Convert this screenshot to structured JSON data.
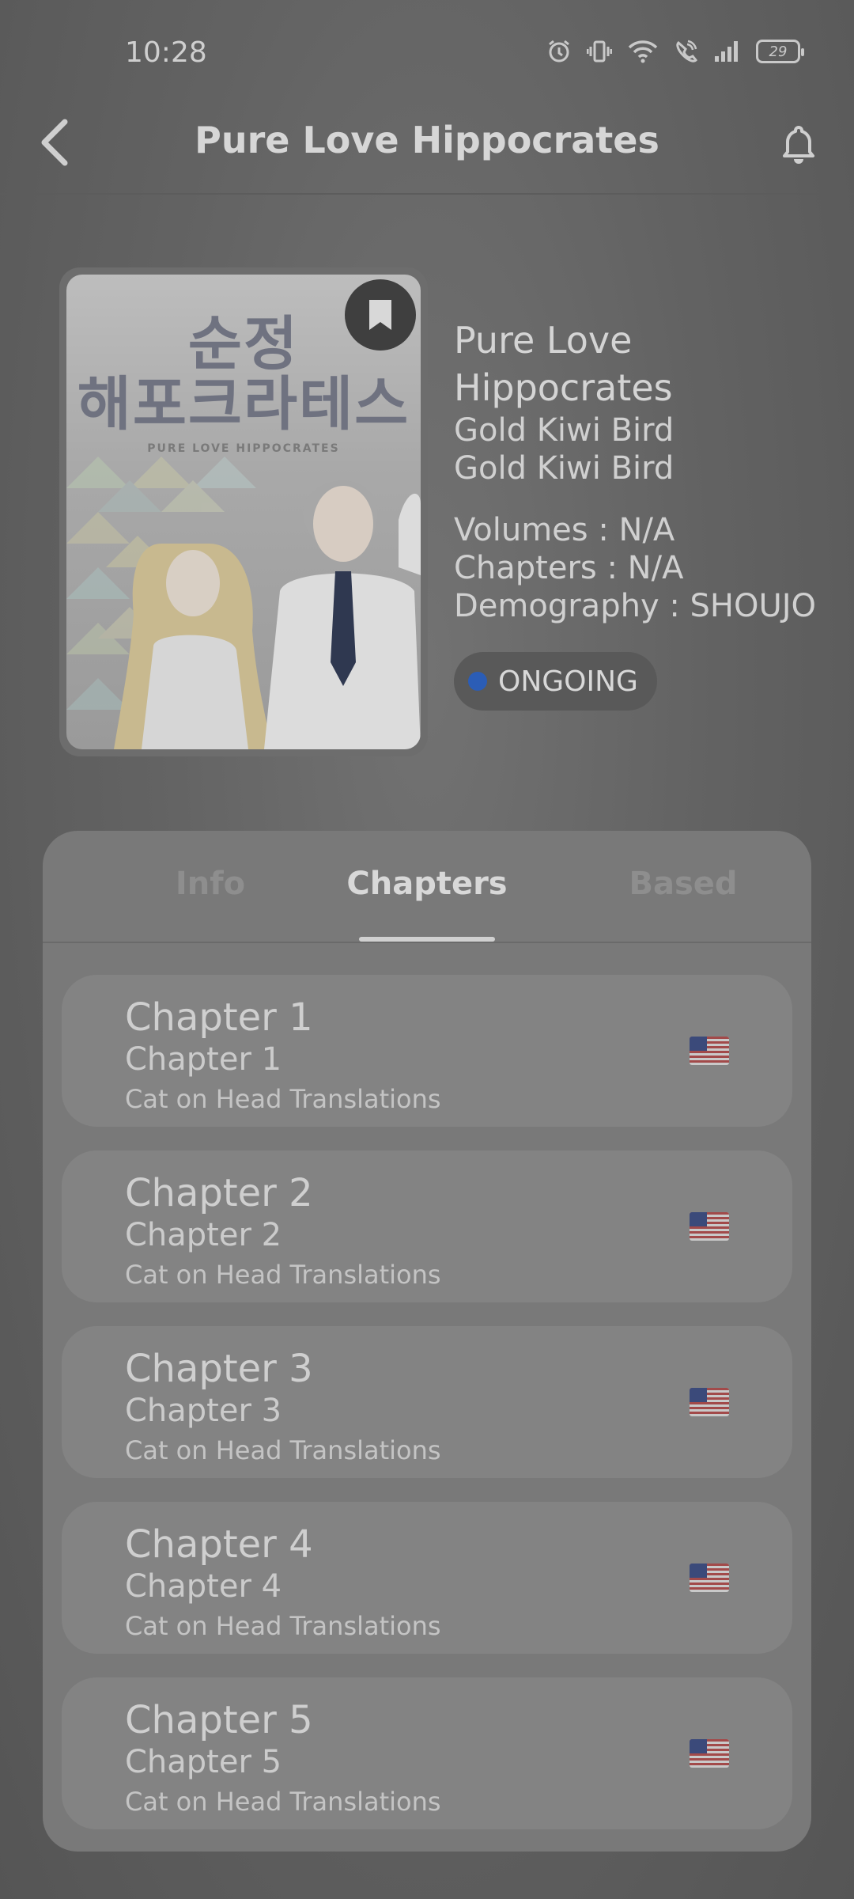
{
  "status_bar": {
    "time": "10:28",
    "battery": "29",
    "icons": [
      "alarm-icon",
      "vibrate-icon",
      "wifi-icon",
      "wifi-calling-icon",
      "signal-icon",
      "battery-icon"
    ]
  },
  "app_bar": {
    "title": "Pure Love Hippocrates",
    "back_icon": "chevron-left-icon",
    "bell_icon": "bell-icon"
  },
  "cover": {
    "title_kr": "순정\n해포크라테스",
    "title_en": "PURE LOVE HIPPOCRATES",
    "bookmark_icon": "bookmark-icon"
  },
  "manga": {
    "title": "Pure Love Hippocrates",
    "author": "Gold Kiwi Bird",
    "artist": "Gold Kiwi Bird",
    "volumes": "Volumes : N/A",
    "chapters": "Chapters : N/A",
    "demography": "Demography : SHOUJO",
    "status": "ONGOING",
    "status_color": "#2b5db6"
  },
  "tabs": [
    {
      "label": "Info",
      "active": false
    },
    {
      "label": "Chapters",
      "active": true
    },
    {
      "label": "Based",
      "active": false
    }
  ],
  "chapters": [
    {
      "title": "Chapter 1",
      "subtitle": "Chapter 1",
      "group": "Cat on Head Translations",
      "flag": "us-flag-icon"
    },
    {
      "title": "Chapter 2",
      "subtitle": "Chapter 2",
      "group": "Cat on Head Translations",
      "flag": "us-flag-icon"
    },
    {
      "title": "Chapter 3",
      "subtitle": "Chapter 3",
      "group": "Cat on Head Translations",
      "flag": "us-flag-icon"
    },
    {
      "title": "Chapter 4",
      "subtitle": "Chapter 4",
      "group": "Cat on Head Translations",
      "flag": "us-flag-icon"
    },
    {
      "title": "Chapter 5",
      "subtitle": "Chapter 5",
      "group": "Cat on Head Translations",
      "flag": "us-flag-icon"
    }
  ]
}
